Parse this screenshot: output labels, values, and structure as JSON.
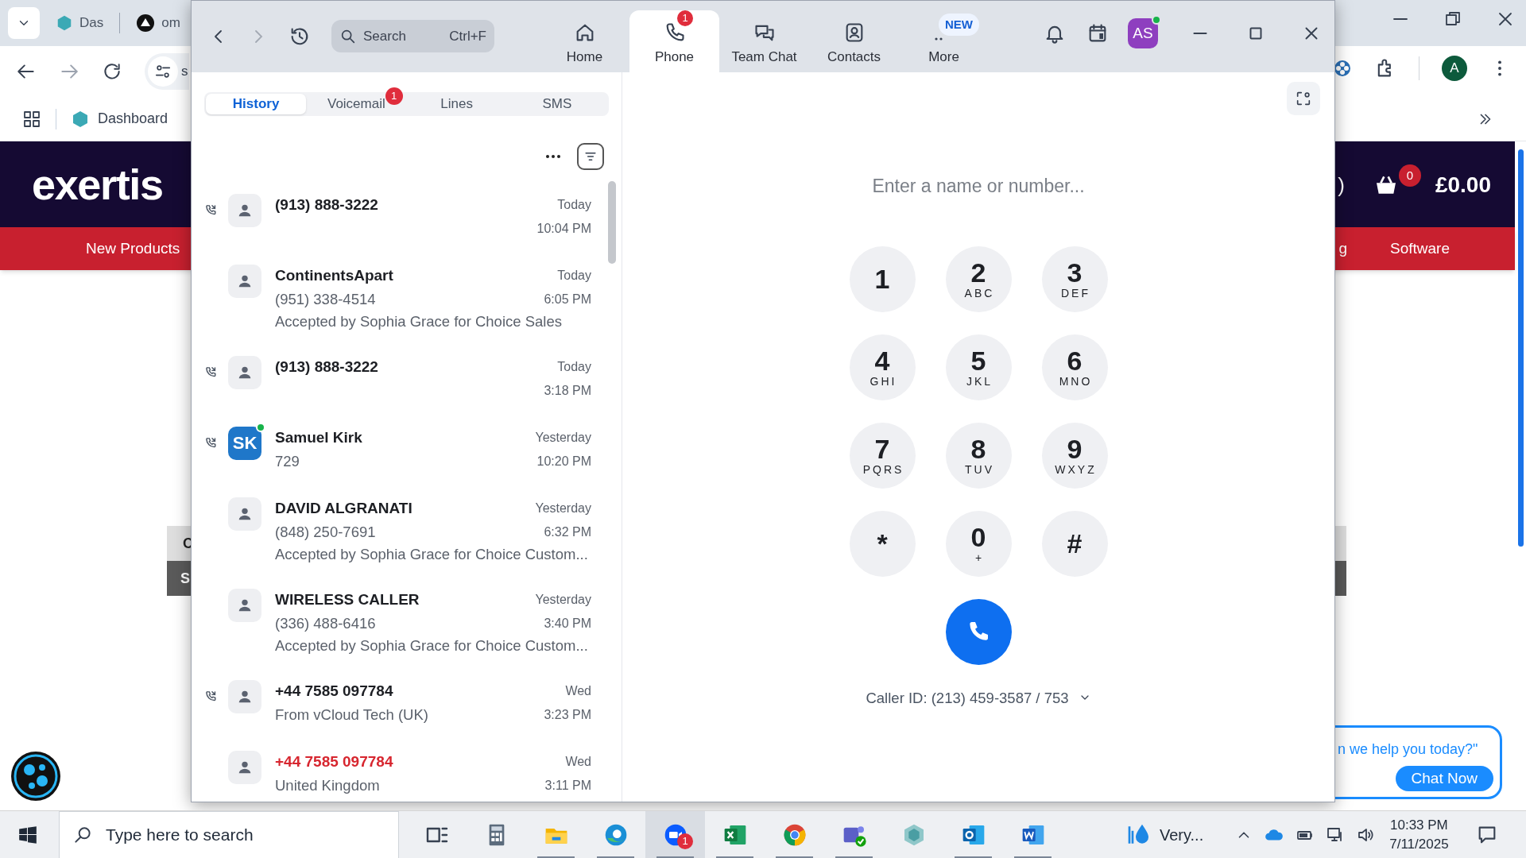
{
  "browser": {
    "tabs": [
      {
        "label": "Das",
        "kind": "diamond"
      },
      {
        "label": "om",
        "kind": "triangle"
      }
    ],
    "address_partial": "s",
    "bookmarks": [
      {
        "label": "Dashboard"
      }
    ],
    "profile": "A"
  },
  "site": {
    "logo": "exertis",
    "header_partial": ")",
    "cart_count": "0",
    "cart_total": "£0.00",
    "nav_left": [
      "New Products"
    ],
    "nav_right": [
      "g",
      "Software"
    ],
    "left_cells": [
      "C",
      "S"
    ],
    "chat_prompt": "n we help you today?\"",
    "chat_button": "Chat Now"
  },
  "zoom": {
    "search": {
      "placeholder": "Search",
      "shortcut": "Ctrl+F"
    },
    "nav": [
      {
        "label": "Home",
        "kind": "home",
        "selected": false
      },
      {
        "label": "Phone",
        "kind": "phone",
        "selected": true,
        "badge": "1"
      },
      {
        "label": "Team Chat",
        "kind": "chat",
        "selected": false
      },
      {
        "label": "Contacts",
        "kind": "contacts",
        "selected": false
      },
      {
        "label": "More",
        "kind": "more",
        "selected": false,
        "tag": "NEW"
      }
    ],
    "avatar": {
      "initials": "AS",
      "online": true
    },
    "sub_tabs": [
      {
        "label": "History",
        "selected": true
      },
      {
        "label": "Voicemail",
        "selected": false,
        "badge": "1"
      },
      {
        "label": "Lines",
        "selected": false
      },
      {
        "label": "SMS",
        "selected": false
      }
    ],
    "calls": [
      {
        "name": "(913) 888-3222",
        "day": "Today",
        "time": "10:04 PM",
        "missed": false,
        "call_icon": true
      },
      {
        "name": "ContinentsApart",
        "details": [
          "(951) 338-4514",
          "Accepted by Sophia Grace for Choice Sales"
        ],
        "day": "Today",
        "time": "6:05 PM",
        "missed": false,
        "call_icon": false
      },
      {
        "name": "(913) 888-3222",
        "day": "Today",
        "time": "3:18 PM",
        "missed": false,
        "call_icon": true
      },
      {
        "name": "Samuel Kirk",
        "details": [
          "729"
        ],
        "day": "Yesterday",
        "time": "10:20 PM",
        "missed": false,
        "call_icon": true,
        "initials": "SK",
        "online": true
      },
      {
        "name": "DAVID ALGRANATI",
        "details": [
          "(848) 250-7691",
          "Accepted by Sophia Grace for Choice Custom..."
        ],
        "day": "Yesterday",
        "time": "6:32 PM",
        "missed": false,
        "call_icon": false
      },
      {
        "name": "WIRELESS CALLER",
        "details": [
          "(336) 488-6416",
          "Accepted by Sophia Grace for Choice Custom..."
        ],
        "day": "Yesterday",
        "time": "3:40 PM",
        "missed": false,
        "call_icon": false
      },
      {
        "name": "+44 7585 097784",
        "details": [
          "From vCloud Tech (UK)"
        ],
        "day": "Wed",
        "time": "3:23 PM",
        "missed": false,
        "call_icon": true
      },
      {
        "name": "+44 7585 097784",
        "details": [
          "United Kingdom"
        ],
        "day": "Wed",
        "time": "3:11 PM",
        "missed": true,
        "call_icon": false
      }
    ],
    "dialer": {
      "placeholder": "Enter a name or number...",
      "keys": [
        {
          "digit": "1"
        },
        {
          "digit": "2",
          "letters": "ABC"
        },
        {
          "digit": "3",
          "letters": "DEF"
        },
        {
          "digit": "4",
          "letters": "GHI"
        },
        {
          "digit": "5",
          "letters": "JKL"
        },
        {
          "digit": "6",
          "letters": "MNO"
        },
        {
          "digit": "7",
          "letters": "PQRS"
        },
        {
          "digit": "8",
          "letters": "TUV"
        },
        {
          "digit": "9",
          "letters": "WXYZ"
        },
        {
          "digit": "*"
        },
        {
          "digit": "0",
          "letters": "+"
        },
        {
          "digit": "#"
        }
      ],
      "caller_id": "Caller ID: (213) 459-3587 / 753"
    }
  },
  "taskbar": {
    "search_placeholder": "Type here to search",
    "apps": [
      {
        "kind": "taskview",
        "running": false,
        "selected": false
      },
      {
        "kind": "calculator",
        "running": false,
        "selected": false
      },
      {
        "kind": "explorer",
        "running": true,
        "selected": false
      },
      {
        "kind": "edge",
        "running": true,
        "selected": false
      },
      {
        "kind": "zoom",
        "running": true,
        "selected": true,
        "badge": "1"
      },
      {
        "kind": "excel",
        "running": true,
        "selected": false
      },
      {
        "kind": "chrome",
        "running": true,
        "selected": false
      },
      {
        "kind": "teams",
        "running": true,
        "selected": false
      },
      {
        "kind": "gem",
        "running": false,
        "selected": false
      },
      {
        "kind": "outlook",
        "running": true,
        "selected": false
      },
      {
        "kind": "word",
        "running": true,
        "selected": false
      }
    ],
    "weather": "Very...",
    "time": "10:33 PM",
    "date": "7/11/2025"
  }
}
